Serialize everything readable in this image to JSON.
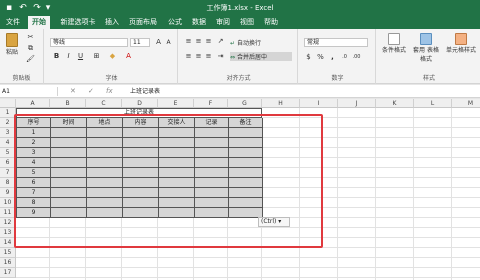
{
  "titlebar": {
    "title": "工作簿1.xlsx  -  Excel",
    "quick_access": [
      "↶",
      "↷",
      "▾"
    ]
  },
  "tabs": [
    "文件",
    "开始",
    "新建选项卡",
    "插入",
    "页面布局",
    "公式",
    "数据",
    "审阅",
    "视图",
    "帮助"
  ],
  "ribbon": {
    "clipboard": {
      "paste": "粘贴",
      "label": "剪贴板"
    },
    "font": {
      "name": "等线",
      "size": "11",
      "label": "字体",
      "bold": "B",
      "italic": "I",
      "underline": "U"
    },
    "align": {
      "wrap": "自动换行",
      "merge": "合并后居中",
      "label": "对齐方式"
    },
    "number": {
      "format": "常规",
      "label": "数字",
      "percent": "%",
      "comma": ","
    },
    "styles": {
      "cond": "条件格式",
      "table": "套用\n表格格式",
      "cell": "单元格样式",
      "label": "样式"
    }
  },
  "formula_bar": {
    "name_box": "A1",
    "fx": "fx",
    "content": "上班记录表"
  },
  "columns": [
    "A",
    "B",
    "C",
    "D",
    "E",
    "F",
    "G",
    "H",
    "I",
    "J",
    "K",
    "L",
    "M"
  ],
  "rows": [
    "1",
    "2",
    "3",
    "4",
    "5",
    "6",
    "7",
    "8",
    "9",
    "10",
    "11",
    "12",
    "13",
    "14",
    "15",
    "16",
    "17"
  ],
  "table": {
    "title": "上班记录表",
    "headers": [
      "序号",
      "时间",
      "地点",
      "内容",
      "交接人",
      "记录",
      "备注"
    ],
    "numbers": [
      "1",
      "2",
      "3",
      "4",
      "5",
      "6",
      "7",
      "8",
      "9"
    ]
  },
  "paste_options": "(Ctrl) ▾",
  "colors": {
    "excel_green": "#217346",
    "highlight": "#e0393e"
  }
}
